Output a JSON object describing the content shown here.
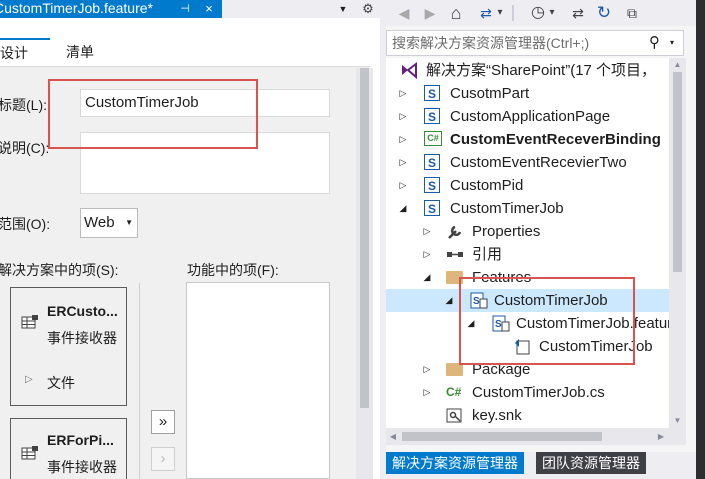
{
  "document_tab": {
    "title": "CustomTimerJob.feature*",
    "pin_glyph": "⊣",
    "close_glyph": "×",
    "dropdown_glyph": "▼",
    "gear_glyph": "⚙"
  },
  "designer": {
    "tabs": [
      {
        "label": "设计",
        "active": true
      },
      {
        "label": "清单",
        "active": false
      }
    ],
    "title_label": "标题(L):",
    "title_value": "CustomTimerJob",
    "description_label": "说明(C):",
    "description_value": "",
    "scope_label": "范围(O):",
    "scope_value": "Web",
    "solution_items_label": "解决方案中的项(S):",
    "feature_items_label": "功能中的项(F):",
    "solution_items": [
      {
        "name": "ERCusto...",
        "type": "事件接收器",
        "child": "文件"
      },
      {
        "name": "ERForPi...",
        "type": "事件接收器"
      }
    ],
    "move_right_label": "»",
    "move_left_label": "›",
    "expand_glyph": "▷"
  },
  "solution_explorer": {
    "search_placeholder": "搜索解决方案资源管理器(Ctrl+;)",
    "search_icon_glyph": "⚲",
    "toolbar_glyphs": {
      "back": "◀",
      "forward": "▶",
      "home": "⌂",
      "sync": "⇄",
      "history": "◷",
      "refresh": "↻",
      "collapse": "⧉",
      "dropdown": "▾"
    },
    "tree": [
      {
        "label": "解决方案“SharePoint”(17 个项目，",
        "icon": "solution-icon",
        "toggle": "",
        "bold": false
      },
      {
        "label": "CusotmPart",
        "icon": "project-icon",
        "toggle": "▷",
        "bold": false
      },
      {
        "label": "CustomApplicationPage",
        "icon": "project-icon",
        "toggle": "▷",
        "bold": false
      },
      {
        "label": "CustomEventReceverBinding",
        "icon": "csharp-project-icon",
        "toggle": "▷",
        "bold": true
      },
      {
        "label": "CustomEventRecevierTwo",
        "icon": "project-icon",
        "toggle": "▷",
        "bold": false
      },
      {
        "label": "CustomPid",
        "icon": "project-icon",
        "toggle": "▷",
        "bold": false
      },
      {
        "label": "CustomTimerJob",
        "icon": "project-icon",
        "toggle": "◢",
        "bold": false
      },
      {
        "label": "Properties",
        "icon": "wrench-icon",
        "toggle": "▷",
        "bold": false
      },
      {
        "label": "引用",
        "icon": "references-icon",
        "toggle": "▷",
        "bold": false
      },
      {
        "label": "Features",
        "icon": "folder-icon",
        "toggle": "◢",
        "bold": false
      },
      {
        "label": "CustomTimerJob",
        "icon": "feature-icon",
        "toggle": "◢",
        "bold": false,
        "selected": true
      },
      {
        "label": "CustomTimerJob.feature",
        "icon": "feature-file-icon",
        "toggle": "◢",
        "bold": false
      },
      {
        "label": "CustomTimerJob",
        "icon": "template-icon",
        "toggle": "",
        "bold": false
      },
      {
        "label": "Package",
        "icon": "folder-icon",
        "toggle": "▷",
        "bold": false
      },
      {
        "label": "CustomTimerJob.cs",
        "icon": "csharp-file-icon",
        "toggle": "▷",
        "bold": false
      },
      {
        "label": "key.snk",
        "icon": "key-icon",
        "toggle": "",
        "bold": false
      }
    ],
    "bottom_tabs": [
      {
        "label": "解决方案资源管理器",
        "active": true
      },
      {
        "label": "团队资源管理器",
        "active": false
      }
    ]
  },
  "colors": {
    "accent": "#007acc",
    "highlight_box": "#d9534f",
    "selection": "#cce8ff"
  }
}
